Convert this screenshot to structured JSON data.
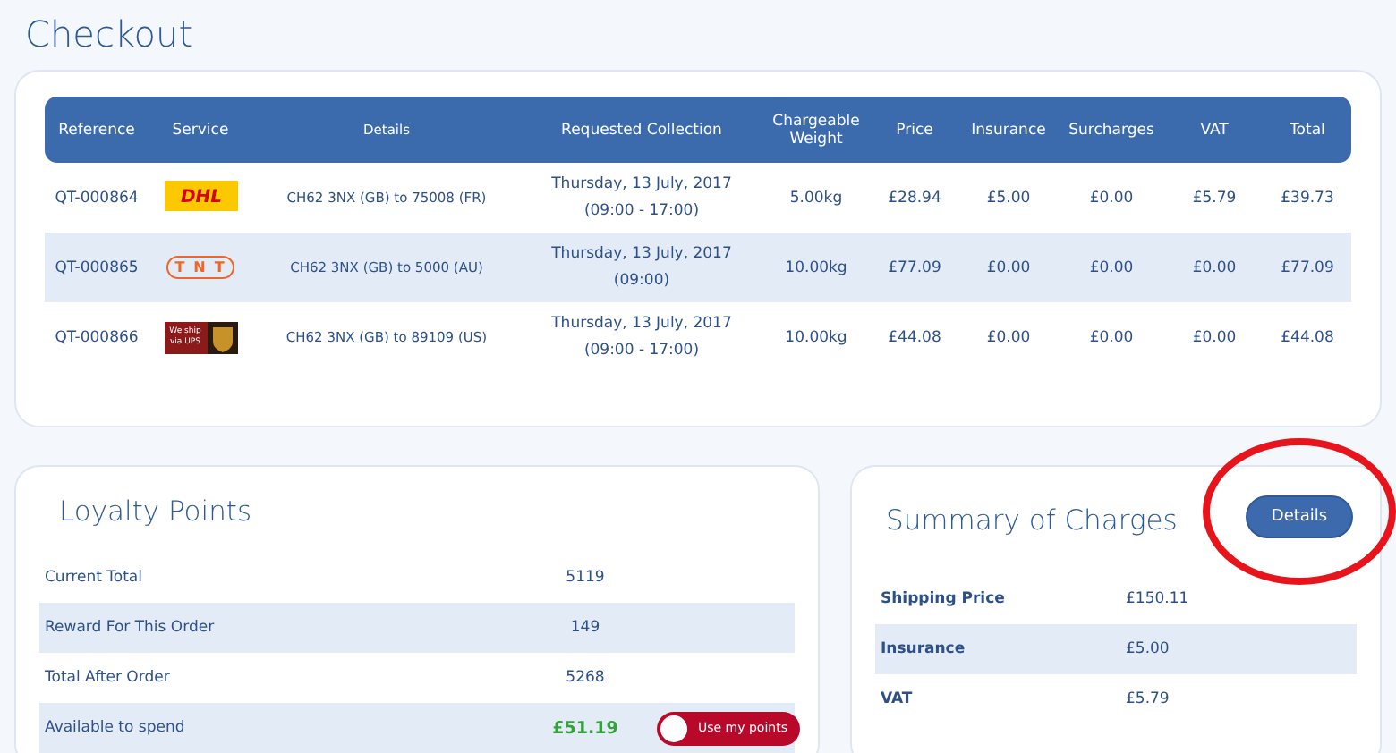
{
  "page_title": "Checkout",
  "quotes": {
    "columns": [
      "Reference",
      "Service",
      "Details",
      "Requested Collection",
      "Chargeable Weight",
      "Price",
      "Insurance",
      "Surcharges",
      "VAT",
      "Total"
    ],
    "rows": [
      {
        "reference": "QT-000864",
        "service": {
          "kind": "dhl",
          "logo_text": "DHL"
        },
        "details": "CH62 3NX (GB) to 75008 (FR)",
        "collection": [
          "Thursday, 13 July, 2017",
          "(09:00 - 17:00)"
        ],
        "weight": "5.00kg",
        "price": "£28.94",
        "insurance": "£5.00",
        "surcharges": "£0.00",
        "vat": "£5.79",
        "total": "£39.73"
      },
      {
        "reference": "QT-000865",
        "service": {
          "kind": "tnt",
          "logo_text": "TNT"
        },
        "details": "CH62 3NX (GB) to 5000 (AU)",
        "collection": [
          "Thursday, 13 July, 2017",
          "(09:00)"
        ],
        "weight": "10.00kg",
        "price": "£77.09",
        "insurance": "£0.00",
        "surcharges": "£0.00",
        "vat": "£0.00",
        "total": "£77.09"
      },
      {
        "reference": "QT-000866",
        "service": {
          "kind": "ups",
          "logo_text": "We ship via UPS"
        },
        "details": "CH62 3NX (GB) to 89109 (US)",
        "collection": [
          "Thursday, 13 July, 2017",
          "(09:00 - 17:00)"
        ],
        "weight": "10.00kg",
        "price": "£44.08",
        "insurance": "£0.00",
        "surcharges": "£0.00",
        "vat": "£0.00",
        "total": "£44.08"
      }
    ]
  },
  "loyalty": {
    "title": "Loyalty Points",
    "rows": [
      {
        "label": "Current Total",
        "value": "5119"
      },
      {
        "label": "Reward For This Order",
        "value": "149"
      },
      {
        "label": "Total After Order",
        "value": "5268"
      },
      {
        "label": "Available to spend",
        "value": "£51.19",
        "kind": "money",
        "toggle": {
          "label": "Use my points",
          "on": false
        }
      }
    ]
  },
  "summary": {
    "title": "Summary of Charges",
    "button": "Details",
    "annotation": {
      "kind": "ellipse",
      "color": "#e8141c"
    },
    "rows": [
      {
        "label": "Shipping Price",
        "value": "£150.11"
      },
      {
        "label": "Insurance",
        "value": "£5.00"
      },
      {
        "label": "VAT",
        "value": "£5.79"
      }
    ]
  }
}
